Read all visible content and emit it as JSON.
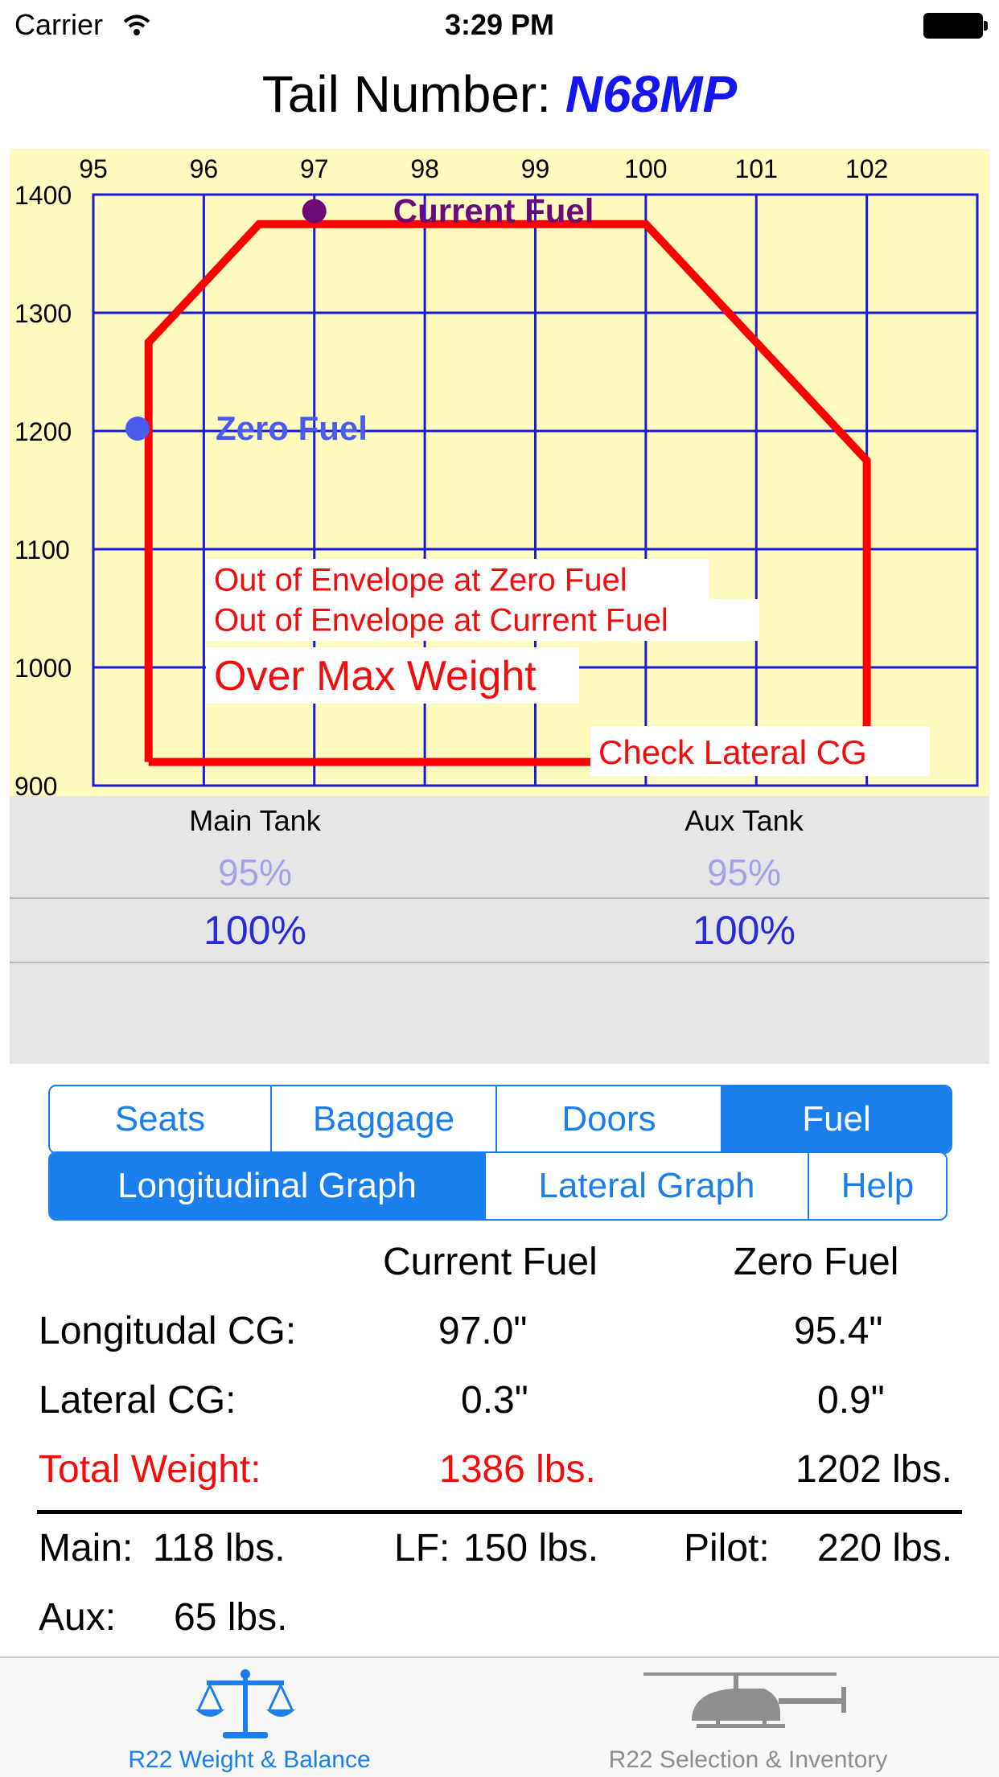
{
  "status_bar": {
    "carrier": "Carrier",
    "time": "3:29 PM"
  },
  "header": {
    "label": "Tail Number:",
    "tail_number": "N68MP"
  },
  "chart_data": {
    "type": "line",
    "x_ticks": [
      95,
      96,
      97,
      98,
      99,
      100,
      101,
      102
    ],
    "y_ticks": [
      900,
      1000,
      1100,
      1200,
      1300,
      1400
    ],
    "xlim": [
      95,
      103
    ],
    "ylim": [
      900,
      1400
    ],
    "grid": true,
    "envelope": {
      "color": "#ff0000",
      "points": [
        [
          95.5,
          920
        ],
        [
          95.5,
          1275
        ],
        [
          96.5,
          1375
        ],
        [
          100,
          1375
        ],
        [
          102,
          1175
        ],
        [
          102,
          950
        ]
      ],
      "bottom_segment": [
        [
          95.5,
          920
        ],
        [
          99.5,
          920
        ]
      ]
    },
    "points": [
      {
        "name": "Current Fuel",
        "x": 97.0,
        "y": 1386,
        "color": "#6b0a78"
      },
      {
        "name": "Zero Fuel",
        "x": 95.4,
        "y": 1202,
        "color": "#4a5cf0"
      }
    ],
    "warnings": [
      "Out of Envelope at Zero Fuel",
      "Out of Envelope at Current Fuel",
      "Over Max Weight",
      "Check Lateral CG"
    ]
  },
  "fuel_picker": {
    "main": {
      "label": "Main Tank",
      "prev": "95%",
      "value": "100%"
    },
    "aux": {
      "label": "Aux Tank",
      "prev": "95%",
      "value": "100%"
    }
  },
  "segment_top": {
    "items": [
      "Seats",
      "Baggage",
      "Doors",
      "Fuel"
    ],
    "selected": "Fuel"
  },
  "segment_bottom": {
    "items": [
      "Longitudinal Graph",
      "Lateral Graph",
      "Help"
    ],
    "selected": "Longitudinal Graph"
  },
  "results": {
    "col_current": "Current Fuel",
    "col_zero": "Zero Fuel",
    "rows": [
      {
        "label": "Longitudal CG:",
        "current": "97.0\"",
        "zero": "95.4\""
      },
      {
        "label": "Lateral CG:",
        "current": "0.3\"",
        "zero": "0.9\""
      },
      {
        "label": "Total Weight:",
        "current": "1386 lbs.",
        "zero": "1202 lbs."
      }
    ],
    "breakdown": {
      "main_label": "Main:",
      "main_value": "118 lbs.",
      "lf_label": "LF:",
      "lf_value": "150 lbs.",
      "pilot_label": "Pilot:",
      "pilot_value": "220 lbs.",
      "aux_label": "Aux:",
      "aux_value": "65 lbs."
    },
    "alert_color": "#f40c0c"
  },
  "tab_bar": {
    "tabs": [
      {
        "label": "R22 Weight & Balance",
        "icon": "scale-icon",
        "active": true
      },
      {
        "label": "R22 Selection & Inventory",
        "icon": "helicopter-icon",
        "active": false
      }
    ]
  }
}
